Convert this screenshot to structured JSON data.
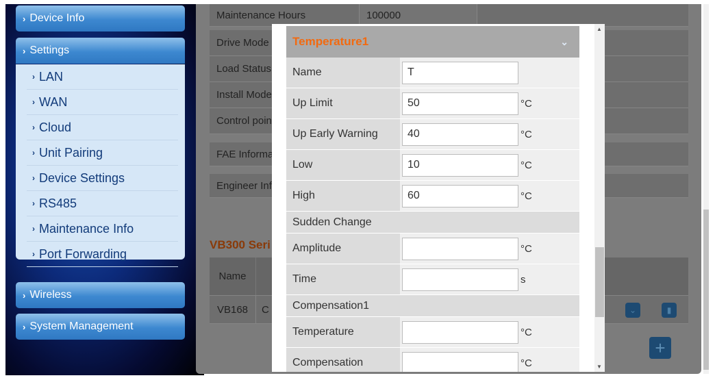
{
  "sidebar": {
    "device_info": "Device Info",
    "settings": "Settings",
    "sub_items": [
      "LAN",
      "WAN",
      "Cloud",
      "Unit Pairing",
      "Device Settings",
      "RS485",
      "Maintenance Info",
      "Port Forwarding"
    ],
    "wireless": "Wireless",
    "system_management": "System Management"
  },
  "background": {
    "rows": [
      {
        "label": "Maintenance Hours",
        "value": "100000"
      },
      {
        "label": "Drive Mode"
      },
      {
        "label": "Load Status"
      },
      {
        "label": "Install Mode"
      },
      {
        "label": "Control poin"
      }
    ],
    "fae": "FAE Informa",
    "engineer": "Engineer Inf",
    "series_title": "VB300 Seri",
    "table": {
      "header_name": "Name",
      "row_name": "VB168",
      "row_col2": "C"
    }
  },
  "modal": {
    "title": "Temperature1",
    "fields": [
      {
        "label": "Name",
        "value": "T",
        "unit": ""
      },
      {
        "label": "Up Limit",
        "value": "50",
        "unit": "°C"
      },
      {
        "label": "Up Early Warning",
        "value": "40",
        "unit": "°C"
      },
      {
        "label": "Low",
        "value": "10",
        "unit": "°C"
      },
      {
        "label": "High",
        "value": "60",
        "unit": "°C"
      }
    ],
    "sudden_change": {
      "title": "Sudden Change",
      "fields": [
        {
          "label": "Amplitude",
          "value": "",
          "unit": "°C"
        },
        {
          "label": "Time",
          "value": "",
          "unit": "s"
        }
      ]
    },
    "compensation": {
      "title": "Compensation1",
      "fields": [
        {
          "label": "Temperature",
          "value": "",
          "unit": "°C"
        },
        {
          "label": "Compensation",
          "value": "",
          "unit": "°C"
        }
      ]
    }
  }
}
